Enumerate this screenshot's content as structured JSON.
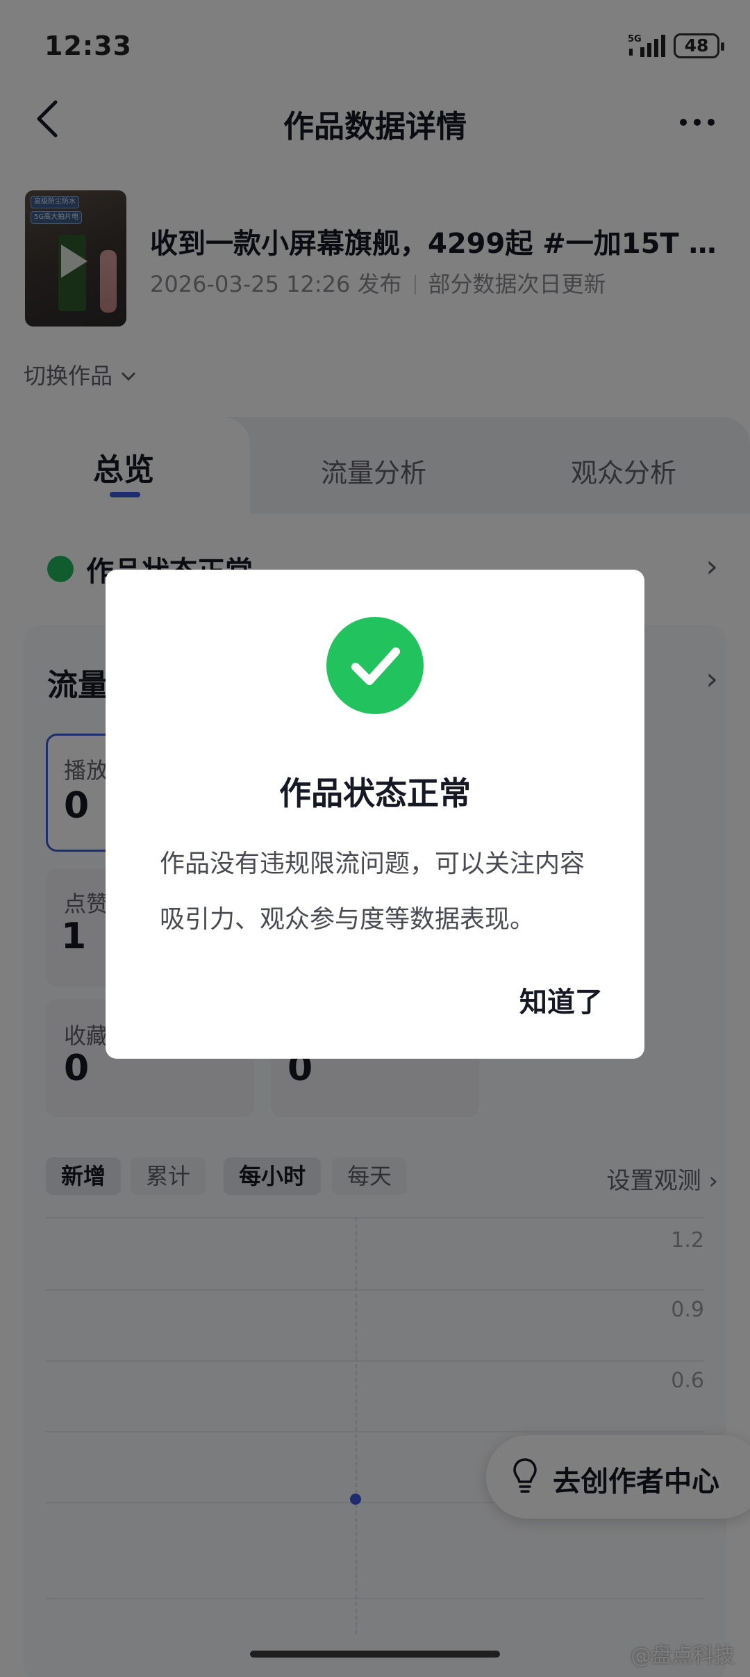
{
  "status_bar": {
    "time": "12:33",
    "network": "5G",
    "battery": "48"
  },
  "nav": {
    "title": "作品数据详情"
  },
  "video": {
    "title": "收到一款小屏幕旗舰，4299起 #一加15T #...",
    "publish_time": "2026-03-25 12:26 发布",
    "update_note": "部分数据次日更新",
    "thumb_chips": [
      "高级防尘防水",
      "5G高大拍片电"
    ]
  },
  "switch_label": "切换作品",
  "tabs": [
    {
      "label": "总览",
      "active": true
    },
    {
      "label": "流量分析",
      "active": false
    },
    {
      "label": "观众分析",
      "active": false
    }
  ],
  "status_row": {
    "label": "作品状态正常"
  },
  "traffic_card": {
    "title": "流量",
    "metrics": [
      {
        "label": "播放",
        "value": "0"
      },
      {
        "label": "点赞",
        "value": "1"
      },
      {
        "label": "收藏",
        "value": "0"
      },
      {
        "label": "",
        "value": "0"
      }
    ]
  },
  "filters": {
    "mode": [
      "新增",
      "累计"
    ],
    "period": [
      "每小时",
      "每天"
    ],
    "settings": "设置观测"
  },
  "chart_data": {
    "type": "line",
    "y_ticks": [
      "1.2",
      "0.9",
      "0.6"
    ],
    "ylim": [
      0,
      1.2
    ],
    "points": [
      {
        "x": "",
        "y": 0
      }
    ]
  },
  "float_button": {
    "label": "去创作者中心"
  },
  "watermark": "@盘点科技",
  "dialog": {
    "title": "作品状态正常",
    "body": "作品没有违规限流问题，可以关注内容吸引力、观众参与度等数据表现。",
    "button": "知道了",
    "icon_color": "#22c35e"
  }
}
